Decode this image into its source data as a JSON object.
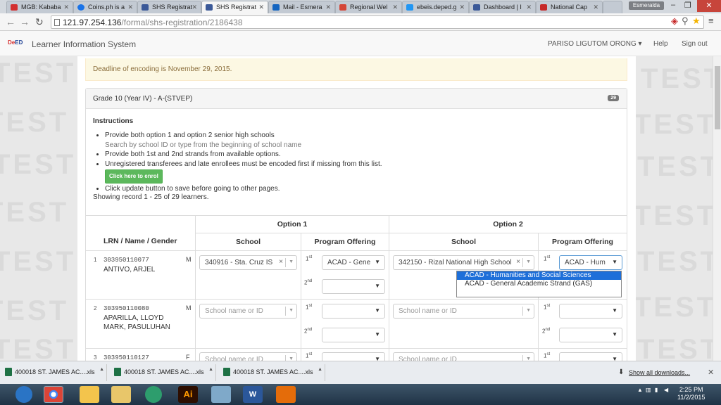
{
  "browser": {
    "tabs": [
      {
        "label": "MGB: Kababa",
        "color": "#d32f2f"
      },
      {
        "label": "Coins.ph is a",
        "color": "#1a73e8"
      },
      {
        "label": "SHS Registrat",
        "color": "#3b5998"
      },
      {
        "label": "SHS Registrat",
        "color": "#3b5998",
        "active": true
      },
      {
        "label": "Mail - Esmera",
        "color": "#1565c0"
      },
      {
        "label": "Regional Wel",
        "color": "#d44638"
      },
      {
        "label": "ebeis.deped.g",
        "color": "#2196f3"
      },
      {
        "label": "Dashboard | I",
        "color": "#3b5998"
      },
      {
        "label": "National Cap",
        "color": "#c62828"
      }
    ],
    "profile": "Esmeralda",
    "url_host": "121.97.254.136",
    "url_path": "/formal/shs-registration/2186438"
  },
  "app": {
    "logo_a": "De",
    "logo_b": "ED",
    "title": "Learner Information System",
    "user": "PARISO LIGUTOM ORONG",
    "help": "Help",
    "signout": "Sign out"
  },
  "watermark": "TEST",
  "alert": "Deadline of encoding is November 29, 2015.",
  "panel": {
    "title": "Grade 10 (Year IV) - A-(STVEP)",
    "badge": "29",
    "instructions_title": "Instructions",
    "instructions": [
      "Provide both option 1 and option 2 senior high schools",
      "Search by school ID or type from the beginning of school name",
      "Provide both 1st and 2nd strands from available options.",
      "Unregistered transferees and late enrollees must be encoded first if missing from this list.",
      "Click here to enrol",
      "Click update button to save before going to other pages."
    ],
    "showing": "Showing record 1 - 25 of 29 learners."
  },
  "table": {
    "col_lrn": "LRN / Name / Gender",
    "option1": "Option 1",
    "option2": "Option 2",
    "school": "School",
    "program": "Program Offering",
    "ord1": "1",
    "ord1_sup": "st",
    "ord2": "2",
    "ord2_sup": "nd",
    "placeholder": "School name or ID",
    "rows": [
      {
        "num": "1",
        "lrn": "303950110077",
        "gender": "M",
        "name": "ANTIVO, ARJEL",
        "school1": "340916 - Sta. Cruz IS",
        "prog1": "ACAD - Gene",
        "school2": "342150 - Rizal National High School",
        "prog2": "ACAD - Hum"
      },
      {
        "num": "2",
        "lrn": "303950110080",
        "gender": "M",
        "name": "APARILLA, LLOYD MARK, PASULUHAN"
      },
      {
        "num": "3",
        "lrn": "303950110127",
        "gender": "F",
        "name": ""
      }
    ]
  },
  "dropdown": {
    "options": [
      "ACAD - Humanities and Social Sciences (HUMSS)",
      "ACAD - General Academic Strand (GAS)"
    ]
  },
  "downloads": {
    "items": [
      "400018 ST. JAMES AC....xls",
      "400018 ST. JAMES AC....xls",
      "400018 ST. JAMES AC....xls"
    ],
    "show_all": "Show all downloads..."
  },
  "taskbar": {
    "time": "2:25 PM",
    "date": "11/2/2015"
  }
}
